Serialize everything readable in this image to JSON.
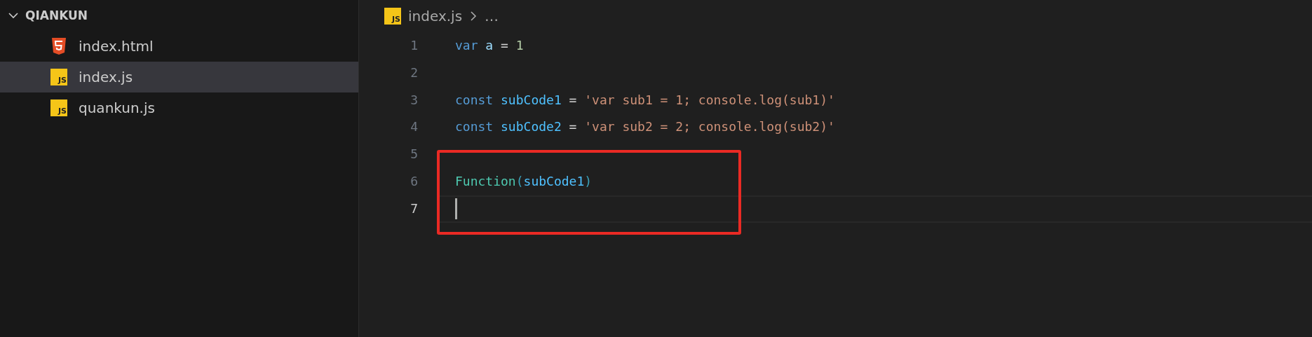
{
  "explorer": {
    "folder": "QIANKUN",
    "expanded": true,
    "files": [
      {
        "name": "index.html",
        "kind": "html",
        "selected": false
      },
      {
        "name": "index.js",
        "kind": "js",
        "badge": "JS",
        "selected": true
      },
      {
        "name": "quankun.js",
        "kind": "js",
        "badge": "JS",
        "selected": false
      }
    ]
  },
  "breadcrumb": {
    "file": "index.js",
    "badge": "JS",
    "more": "…"
  },
  "editor": {
    "lines": [
      {
        "number": "1",
        "current": false,
        "highlighted": false,
        "tokens": [
          {
            "kind": "keyword",
            "text": "var "
          },
          {
            "kind": "variable",
            "text": "a"
          },
          {
            "kind": "operator",
            "text": " = "
          },
          {
            "kind": "number",
            "text": "1"
          }
        ]
      },
      {
        "number": "2",
        "current": false,
        "highlighted": false
      },
      {
        "number": "3",
        "current": false,
        "highlighted": false,
        "tokens": [
          {
            "kind": "keyword",
            "text": "const "
          },
          {
            "kind": "constant",
            "text": "subCode1"
          },
          {
            "kind": "operator",
            "text": " = "
          },
          {
            "kind": "string",
            "text": "'var sub1 = 1; console.log(sub1)'"
          }
        ]
      },
      {
        "number": "4",
        "current": false,
        "highlighted": false,
        "tokens": [
          {
            "kind": "keyword",
            "text": "const "
          },
          {
            "kind": "constant",
            "text": "subCode2"
          },
          {
            "kind": "operator",
            "text": " = "
          },
          {
            "kind": "string",
            "text": "'var sub2 = 2; console.log(sub2)'"
          }
        ]
      },
      {
        "number": "5",
        "current": false,
        "highlighted": true
      },
      {
        "number": "6",
        "current": false,
        "highlighted": true,
        "tokens": [
          {
            "kind": "class",
            "text": "Function"
          },
          {
            "kind": "bracket",
            "text": "("
          },
          {
            "kind": "constant",
            "text": "subCode1"
          },
          {
            "kind": "bracket",
            "text": ")"
          }
        ]
      },
      {
        "number": "7",
        "current": true,
        "highlighted": true
      }
    ]
  }
}
